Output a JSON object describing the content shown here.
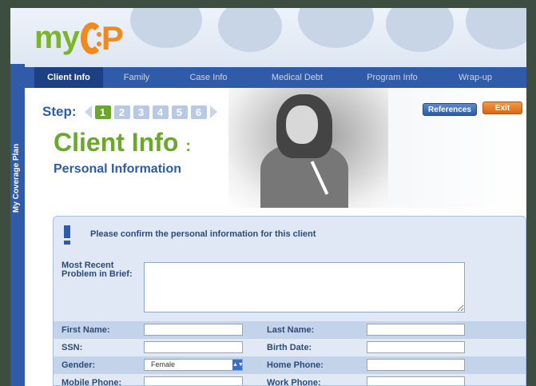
{
  "brand": {
    "logo_text": "my",
    "logo_mark": "CP",
    "sidebar_title": "My Coverage Plan",
    "colors": {
      "brand_blue": "#2f5ba8",
      "brand_green": "#6aa72a",
      "brand_orange": "#f08a1c"
    }
  },
  "tabs": [
    {
      "label": "Client Info",
      "active": true
    },
    {
      "label": "Family"
    },
    {
      "label": "Case Info"
    },
    {
      "label": "Medical Debt"
    },
    {
      "label": "Program Info"
    },
    {
      "label": "Wrap-up"
    }
  ],
  "step": {
    "label": "Step:",
    "current": 1,
    "items": [
      "1",
      "2",
      "3",
      "4",
      "5",
      "6"
    ]
  },
  "page": {
    "title": "Client Info",
    "title_colon": ":",
    "subtitle": "Personal Information"
  },
  "buttons": {
    "references": "References",
    "exit": "Exit"
  },
  "form": {
    "message": "Please confirm the personal information for this client",
    "brief_label": "Most Recent Problem in Brief:",
    "brief_value": "",
    "fields": {
      "first_name": {
        "label": "First Name:",
        "value": ""
      },
      "last_name": {
        "label": "Last Name:",
        "value": ""
      },
      "ssn": {
        "label": "SSN:",
        "value": ""
      },
      "birth_date": {
        "label": "Birth Date:",
        "value": ""
      },
      "gender": {
        "label": "Gender:",
        "value": "Female"
      },
      "home_phone": {
        "label": "Home Phone:",
        "value": ""
      },
      "mobile_phone": {
        "label": "Mobile Phone:",
        "value": ""
      },
      "work_phone": {
        "label": "Work Phone:",
        "value": ""
      }
    }
  }
}
